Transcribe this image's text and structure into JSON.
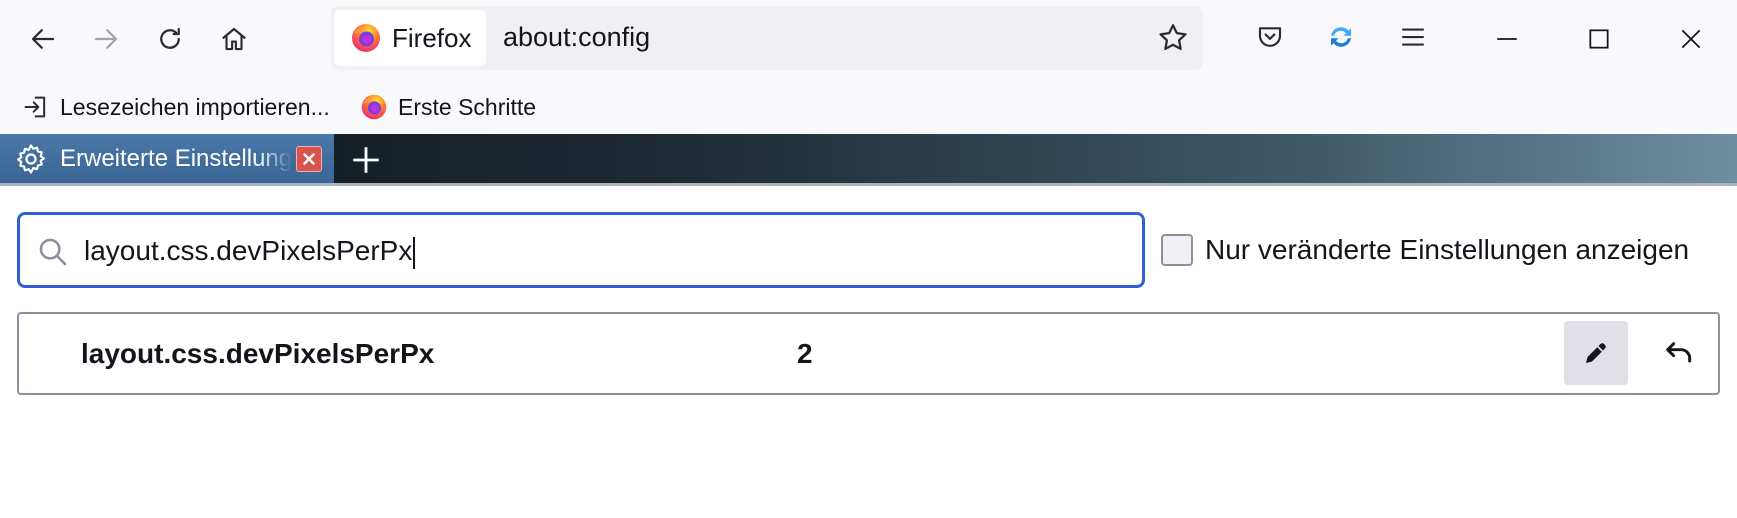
{
  "navbar": {
    "back_icon": "back-arrow-icon",
    "forward_icon": "forward-arrow-icon",
    "reload_icon": "reload-icon",
    "home_icon": "home-icon",
    "identity_label": "Firefox",
    "url": "about:config",
    "bookmark_icon": "star-icon",
    "pocket_icon": "pocket-icon",
    "sync_icon": "sync-icon",
    "menu_icon": "hamburger-menu-icon"
  },
  "window_controls": {
    "minimize_icon": "minimize-icon",
    "maximize_icon": "maximize-icon",
    "close_icon": "close-icon"
  },
  "bookmarks": {
    "items": [
      {
        "label": "Lesezeichen importieren...",
        "icon": "import-icon"
      },
      {
        "label": "Erste Schritte",
        "icon": "firefox-logo-icon"
      }
    ]
  },
  "tabs": {
    "active": {
      "label": "Erweiterte Einstellungen",
      "icon": "gear-icon"
    },
    "new_tab_icon": "plus-icon"
  },
  "config": {
    "search": {
      "value": "layout.css.devPixelsPerPx"
    },
    "modified_only": {
      "label": "Nur veränderte Einstellungen anzeigen",
      "checked": false
    },
    "rows": [
      {
        "name": "layout.css.devPixelsPerPx",
        "value": "2",
        "edit_icon": "pencil-icon",
        "reset_icon": "undo-icon"
      }
    ]
  },
  "colors": {
    "accent": "#2f61d4",
    "toolbar_bg": "#f9f9fb",
    "tab_bg": "#3a6594",
    "tab_close": "#d9534f"
  }
}
